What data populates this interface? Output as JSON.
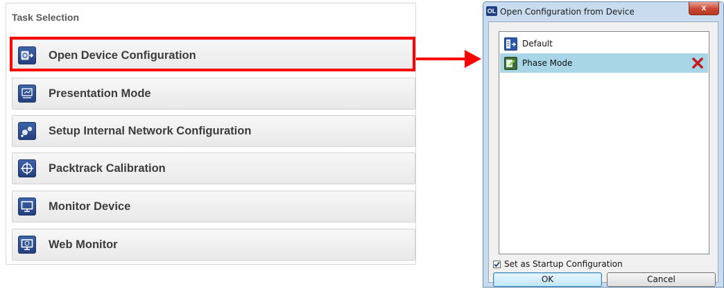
{
  "task_panel": {
    "title": "Task Selection",
    "items": [
      {
        "label": "Open Device Configuration",
        "icon": "open-config-icon"
      },
      {
        "label": "Presentation Mode",
        "icon": "presentation-icon"
      },
      {
        "label": "Setup Internal Network Configuration",
        "icon": "network-icon"
      },
      {
        "label": "Packtrack Calibration",
        "icon": "crosshair-icon"
      },
      {
        "label": "Monitor Device",
        "icon": "monitor-icon"
      },
      {
        "label": "Web Monitor",
        "icon": "web-monitor-icon"
      }
    ],
    "highlighted_item": "Open Device Configuration",
    "highlight_color": "#ff0000"
  },
  "dialog": {
    "title": "Open Configuration from Device",
    "app_icon_text": "OL",
    "close_glyph": "x",
    "configurations": [
      {
        "label": "Default",
        "selected": false,
        "icon": "config-icon"
      },
      {
        "label": "Phase Mode",
        "selected": true,
        "icon": "config-edit-icon",
        "delete_icon": "delete-x-icon"
      }
    ],
    "startup_checkbox": {
      "label": "Set as Startup Configuration",
      "checked": true
    },
    "ok_label": "OK",
    "cancel_label": "Cancel"
  }
}
